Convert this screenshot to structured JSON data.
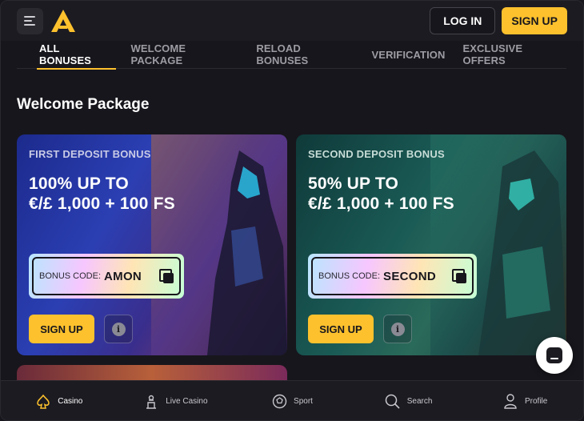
{
  "header": {
    "login_label": "LOG IN",
    "signup_label": "SIGN UP",
    "menu_icon": "menu-icon",
    "logo_icon": "brand-logo"
  },
  "tabs": [
    {
      "label": "ALL BONUSES",
      "active": true
    },
    {
      "label": "WELCOME PACKAGE",
      "active": false
    },
    {
      "label": "RELOAD BONUSES",
      "active": false
    },
    {
      "label": "VERIFICATION",
      "active": false
    },
    {
      "label": "EXCLUSIVE OFFERS",
      "active": false
    }
  ],
  "section": {
    "title": "Welcome Package"
  },
  "cards": [
    {
      "label": "FIRST DEPOSIT BONUS",
      "headline_line1": "100% UP TO",
      "headline_line2": "€/£ 1,000 + 100 FS",
      "code_label": "BONUS CODE:",
      "code_value": "AMON",
      "signup_label": "SIGN UP"
    },
    {
      "label": "SECOND DEPOSIT BONUS",
      "headline_line1": "50% UP TO",
      "headline_line2": "€/£ 1,000 + 100 FS",
      "code_label": "BONUS CODE:",
      "code_value": "SECOND",
      "signup_label": "SIGN UP"
    }
  ],
  "bottom_nav": [
    {
      "label": "Casino",
      "icon": "spade-icon",
      "active": true
    },
    {
      "label": "Live Casino",
      "icon": "dealer-icon",
      "active": false
    },
    {
      "label": "Sport",
      "icon": "soccer-ball-icon",
      "active": false
    },
    {
      "label": "Search",
      "icon": "search-icon",
      "active": false
    },
    {
      "label": "Profile",
      "icon": "profile-icon",
      "active": false
    }
  ],
  "colors": {
    "accent": "#fcc12d",
    "background": "#17161c",
    "header_bg": "#1c1b21",
    "tab_inactive": "#9d9ca4"
  }
}
